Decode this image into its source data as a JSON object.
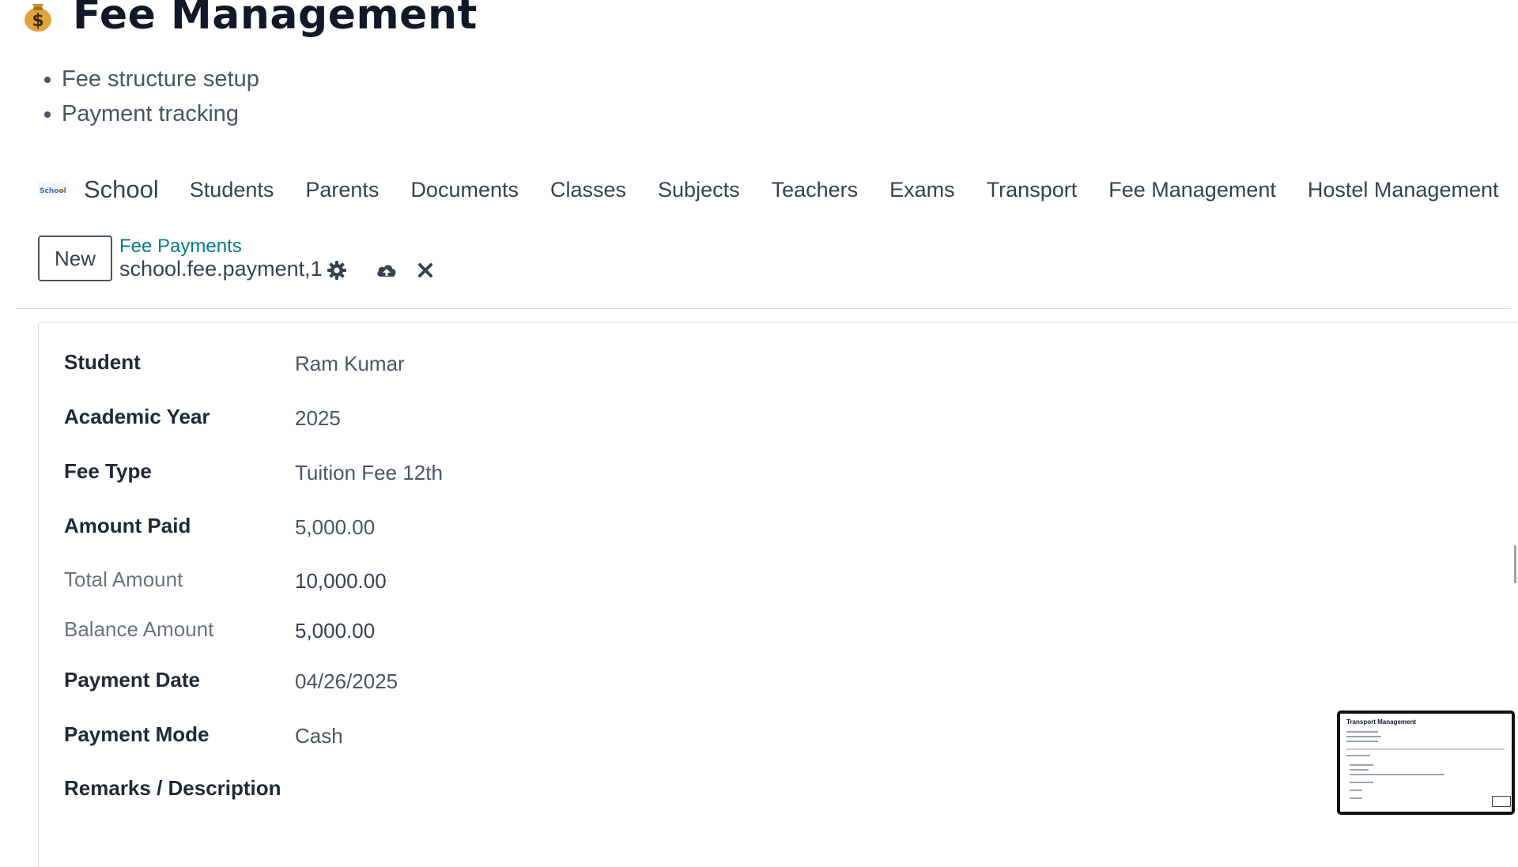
{
  "document": {
    "title": "Fee Management",
    "bullets": [
      "Fee structure setup",
      "Payment tracking"
    ]
  },
  "navbar": {
    "logo_text": "School",
    "brand": "School",
    "items": [
      "Students",
      "Parents",
      "Documents",
      "Classes",
      "Subjects",
      "Teachers",
      "Exams",
      "Transport",
      "Fee Management",
      "Hostel Management"
    ]
  },
  "control_panel": {
    "new_label": "New",
    "breadcrumb_parent": "Fee Payments",
    "record_name": "school.fee.payment,1",
    "icons": [
      "gear-icon",
      "cloud-upload-icon",
      "close-icon"
    ]
  },
  "form": {
    "fields": [
      {
        "label": "Student",
        "value": "Ram Kumar"
      },
      {
        "label": "Academic Year",
        "value": "2025"
      },
      {
        "label": "Fee Type",
        "value": "Tuition Fee 12th"
      },
      {
        "label": "Amount Paid",
        "value": "5,000.00"
      },
      {
        "label": "Total Amount",
        "value": "10,000.00"
      },
      {
        "label": "Balance Amount",
        "value": "5,000.00"
      },
      {
        "label": "Payment Date",
        "value": "04/26/2025"
      },
      {
        "label": "Payment Mode",
        "value": "Cash"
      },
      {
        "label": "Remarks / Description",
        "value": ""
      }
    ]
  },
  "thumbnail": {
    "title": "Transport Management"
  },
  "colors": {
    "accent_link": "#017e84",
    "text_primary": "#1f2937",
    "text_muted": "#6b7280",
    "border": "#d9dde3"
  }
}
